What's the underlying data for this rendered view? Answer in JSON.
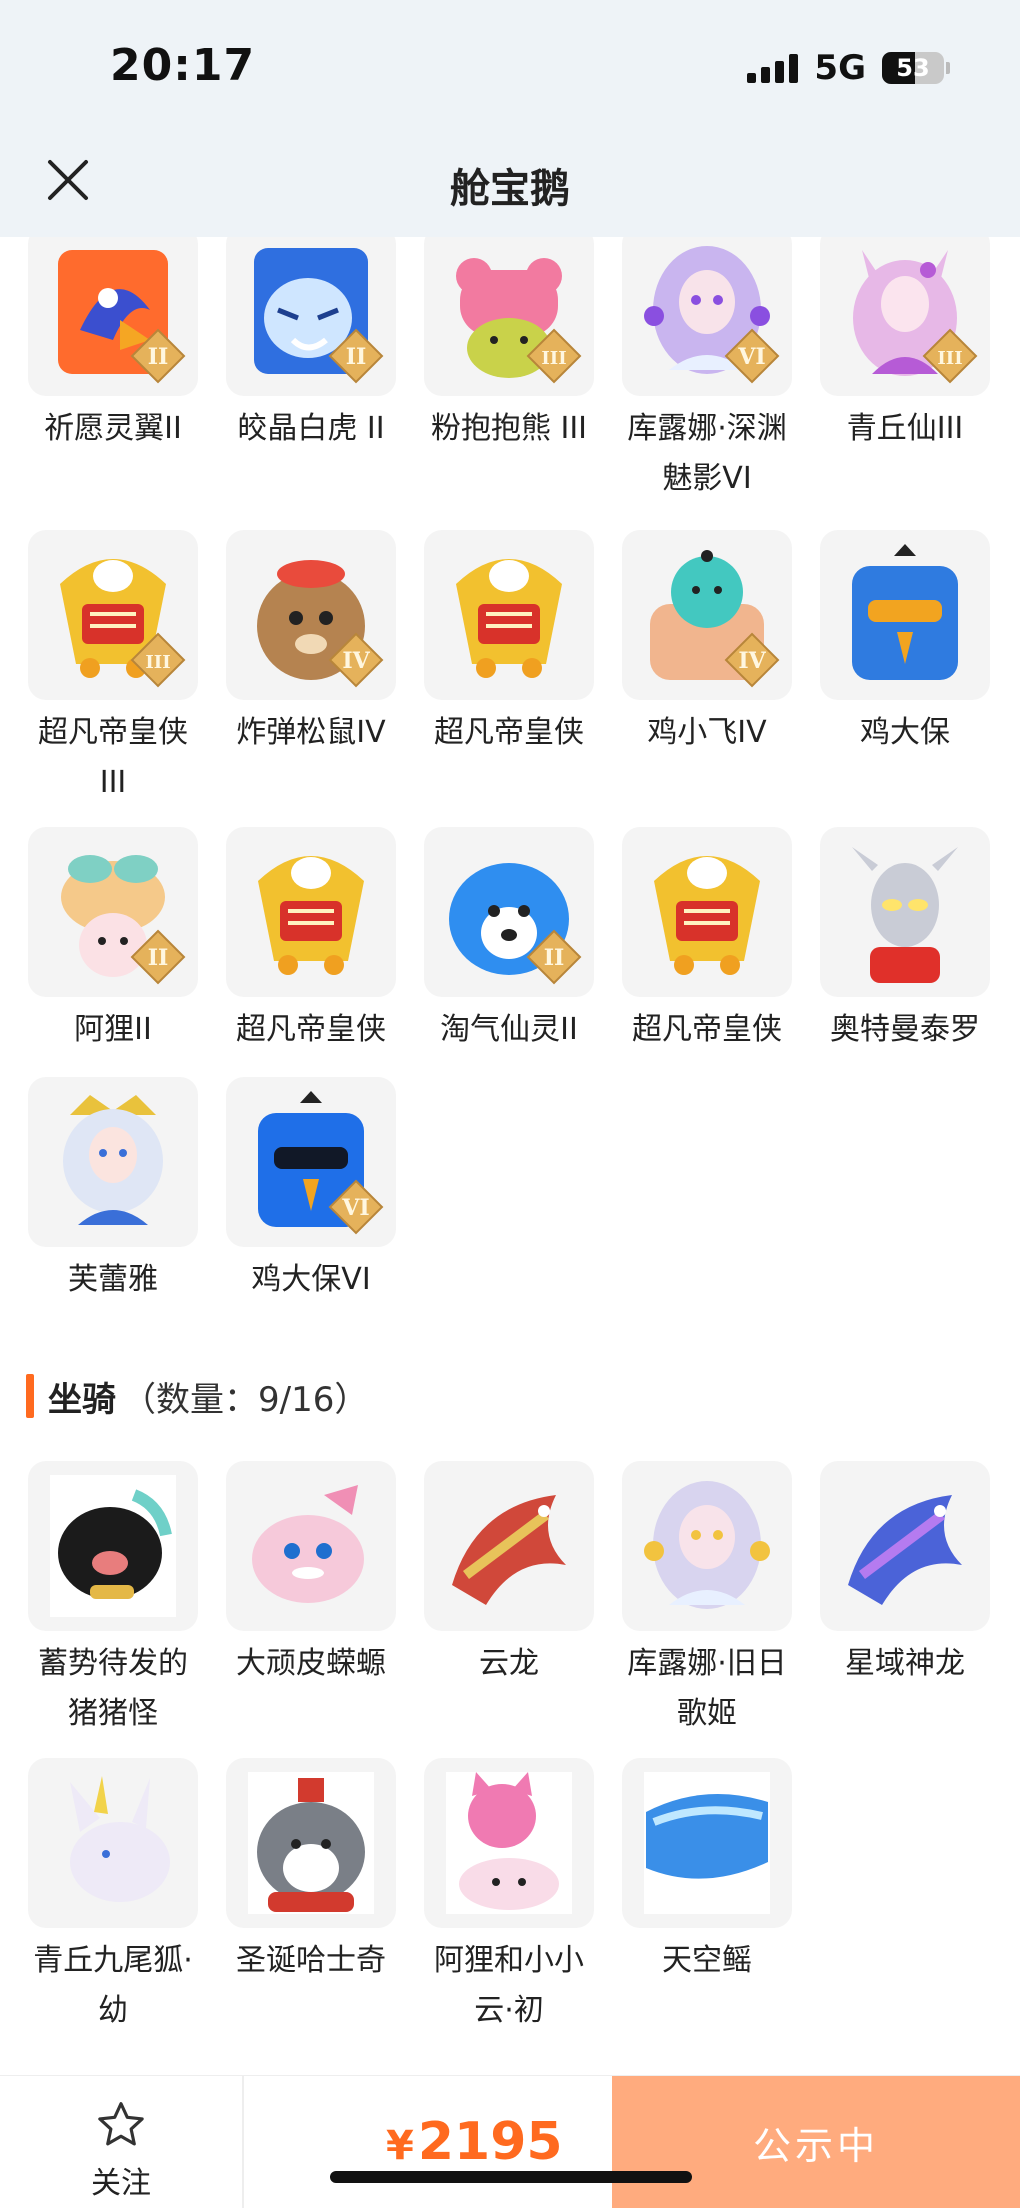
{
  "status_bar": {
    "time": "20:17",
    "network": "5G",
    "battery": "53",
    "battery_level": 0.53
  },
  "header": {
    "title": "舱宝鹅"
  },
  "pets": [
    {
      "label": "祈愿灵翼II",
      "art": "bird",
      "bg": "#ff6b2d",
      "accent": "#3b4fcf",
      "badge": "II"
    },
    {
      "label": "皎晶白虎 II",
      "art": "tiger",
      "bg": "#2f6fe0",
      "accent": "#cfe6ff",
      "badge": "II"
    },
    {
      "label": "粉抱抱熊 III",
      "art": "bear",
      "bg": "#f27aa0",
      "accent": "#c9d24a",
      "badge": "III"
    },
    {
      "label": "库露娜·深渊魅影VI",
      "art": "girl",
      "bg": "#c9b5ef",
      "accent": "#8a4fe0",
      "badge": "VI"
    },
    {
      "label": "青丘仙III",
      "art": "fox-girl",
      "bg": "#e7b8e7",
      "accent": "#b65bd6",
      "badge": "III"
    },
    {
      "label": "超凡帝皇侠III",
      "art": "armor",
      "bg": "#f2c12f",
      "accent": "#d8322a",
      "badge": "III"
    },
    {
      "label": "炸弹松鼠IV",
      "art": "squirrel",
      "bg": "#b58350",
      "accent": "#e94b3c",
      "badge": "IV"
    },
    {
      "label": "超凡帝皇侠",
      "art": "armor",
      "bg": "#f2c12f",
      "accent": "#d8322a",
      "badge": ""
    },
    {
      "label": "鸡小飞IV",
      "art": "chick",
      "bg": "#43c8c0",
      "accent": "#f1b58e",
      "badge": "IV"
    },
    {
      "label": "鸡大保",
      "art": "bigbird",
      "bg": "#2f7be0",
      "accent": "#f2a420",
      "badge": ""
    },
    {
      "label": "阿狸II",
      "art": "cat",
      "bg": "#f5c98a",
      "accent": "#7fd0c4",
      "badge": "II"
    },
    {
      "label": "超凡帝皇侠",
      "art": "armor",
      "bg": "#f2c12f",
      "accent": "#d8322a",
      "badge": ""
    },
    {
      "label": "淘气仙灵II",
      "art": "dog",
      "bg": "#2f8ef0",
      "accent": "#ffffff",
      "badge": "II"
    },
    {
      "label": "超凡帝皇侠",
      "art": "armor",
      "bg": "#f2c12f",
      "accent": "#d8322a",
      "badge": ""
    },
    {
      "label": "奥特曼泰罗",
      "art": "hero",
      "bg": "#c9ccd6",
      "accent": "#e0302a",
      "badge": ""
    },
    {
      "label": "芙蕾雅",
      "art": "queen",
      "bg": "#dfe6f5",
      "accent": "#e9c23c",
      "badge": ""
    },
    {
      "label": "鸡大保VI",
      "art": "bigbird",
      "bg": "#1f6fe8",
      "accent": "#111827",
      "badge": "VI"
    }
  ],
  "mounts_section": {
    "title": "坐骑",
    "count": "（数量：9/16）"
  },
  "mounts": [
    {
      "label": "蓄势待发的猪猪怪",
      "art": "pig",
      "bg": "#1b1b1b",
      "accent": "#6fd0c8",
      "badge": ""
    },
    {
      "label": "大顽皮蝾螈",
      "art": "axolotl",
      "bg": "#f6c9da",
      "accent": "#ffffff",
      "badge": ""
    },
    {
      "label": "云龙",
      "art": "dragon",
      "bg": "#d0483a",
      "accent": "#e8c35a",
      "badge": ""
    },
    {
      "label": "库露娜·旧日歌姬",
      "art": "girl",
      "bg": "#d8d4ef",
      "accent": "#f2c33f",
      "badge": ""
    },
    {
      "label": "星域神龙",
      "art": "dragon",
      "bg": "#4b63d8",
      "accent": "#b57bf0",
      "badge": ""
    },
    {
      "label": "青丘九尾狐·幼",
      "art": "fox",
      "bg": "#eeeaf7",
      "accent": "#f2d34a",
      "badge": ""
    },
    {
      "label": "圣诞哈士奇",
      "art": "husky",
      "bg": "#d23a2e",
      "accent": "#7a7f87",
      "badge": ""
    },
    {
      "label": "阿狸和小小云·初",
      "art": "cat-cloud",
      "bg": "#f07ab2",
      "accent": "#ffffff",
      "badge": ""
    },
    {
      "label": "天空鳐",
      "art": "ray",
      "bg": "#3a8fe8",
      "accent": "#bfe8ff",
      "badge": ""
    }
  ],
  "bottom_bar": {
    "follow_label": "关注",
    "currency": "¥",
    "price": "2195",
    "status": "公示中"
  },
  "colors": {
    "accent": "#ff6a1f",
    "status_button": "#ffab7e",
    "tile_bg": "#f4f4f4"
  },
  "icons": {
    "close": "close-icon",
    "follow": "star-icon"
  }
}
